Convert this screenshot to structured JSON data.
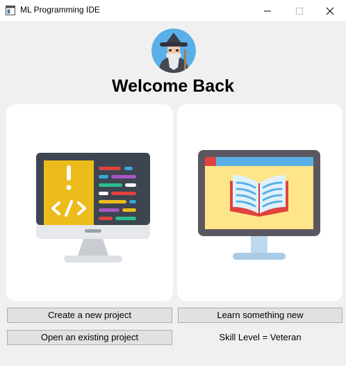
{
  "window": {
    "title": "ML Programming IDE"
  },
  "header": {
    "welcome": "Welcome Back"
  },
  "actions": {
    "create_label": "Create a new project",
    "learn_label": "Learn something new",
    "open_label": "Open an existing project"
  },
  "status": {
    "skill_level": "Skill Level = Veteran"
  },
  "icons": {
    "avatar": "wizard-avatar-icon",
    "left_card": "code-monitor-icon",
    "right_card": "book-monitor-icon"
  },
  "colors": {
    "background": "#f0f0f0",
    "card": "#ffffff",
    "button": "#e1e1e1"
  }
}
